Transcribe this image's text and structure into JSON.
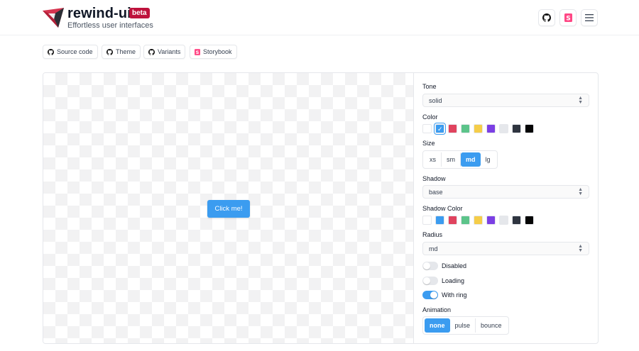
{
  "header": {
    "brand": "rewind-ui",
    "badge": "beta",
    "tagline": "Effortless user interfaces",
    "icons": [
      "github-icon",
      "storybook-icon",
      "menu-icon"
    ]
  },
  "links": [
    {
      "label": "Source code",
      "icon": "github-icon"
    },
    {
      "label": "Theme",
      "icon": "github-icon"
    },
    {
      "label": "Variants",
      "icon": "github-icon"
    },
    {
      "label": "Storybook",
      "icon": "storybook-icon"
    }
  ],
  "preview": {
    "button_label": "Click me!"
  },
  "controls": {
    "tone": {
      "label": "Tone",
      "value": "solid"
    },
    "color": {
      "label": "Color",
      "selected": 1,
      "swatches": [
        "#ffffff",
        "#3b9cf0",
        "#e0435e",
        "#5cc48a",
        "#f5cd49",
        "#7b3fe4",
        "#e5e7eb",
        "#2f3540",
        "#050505"
      ]
    },
    "size": {
      "label": "Size",
      "options": [
        "xs",
        "sm",
        "md",
        "lg"
      ],
      "active": "md"
    },
    "shadow": {
      "label": "Shadow",
      "value": "base"
    },
    "shadow_color": {
      "label": "Shadow Color",
      "swatches": [
        "#ffffff",
        "#3b9cf0",
        "#e0435e",
        "#5cc48a",
        "#f5cd49",
        "#7b3fe4",
        "#e5e7eb",
        "#2f3540",
        "#050505"
      ]
    },
    "radius": {
      "label": "Radius",
      "value": "md"
    },
    "toggles": [
      {
        "label": "Disabled",
        "on": false
      },
      {
        "label": "Loading",
        "on": false
      },
      {
        "label": "With ring",
        "on": true
      }
    ],
    "animation": {
      "label": "Animation",
      "options": [
        "none",
        "pulse",
        "bounce"
      ],
      "active": "none"
    }
  },
  "colors": {
    "accent": "#3b9cf0",
    "badge": "#be123c",
    "logo": "#d6344f"
  }
}
